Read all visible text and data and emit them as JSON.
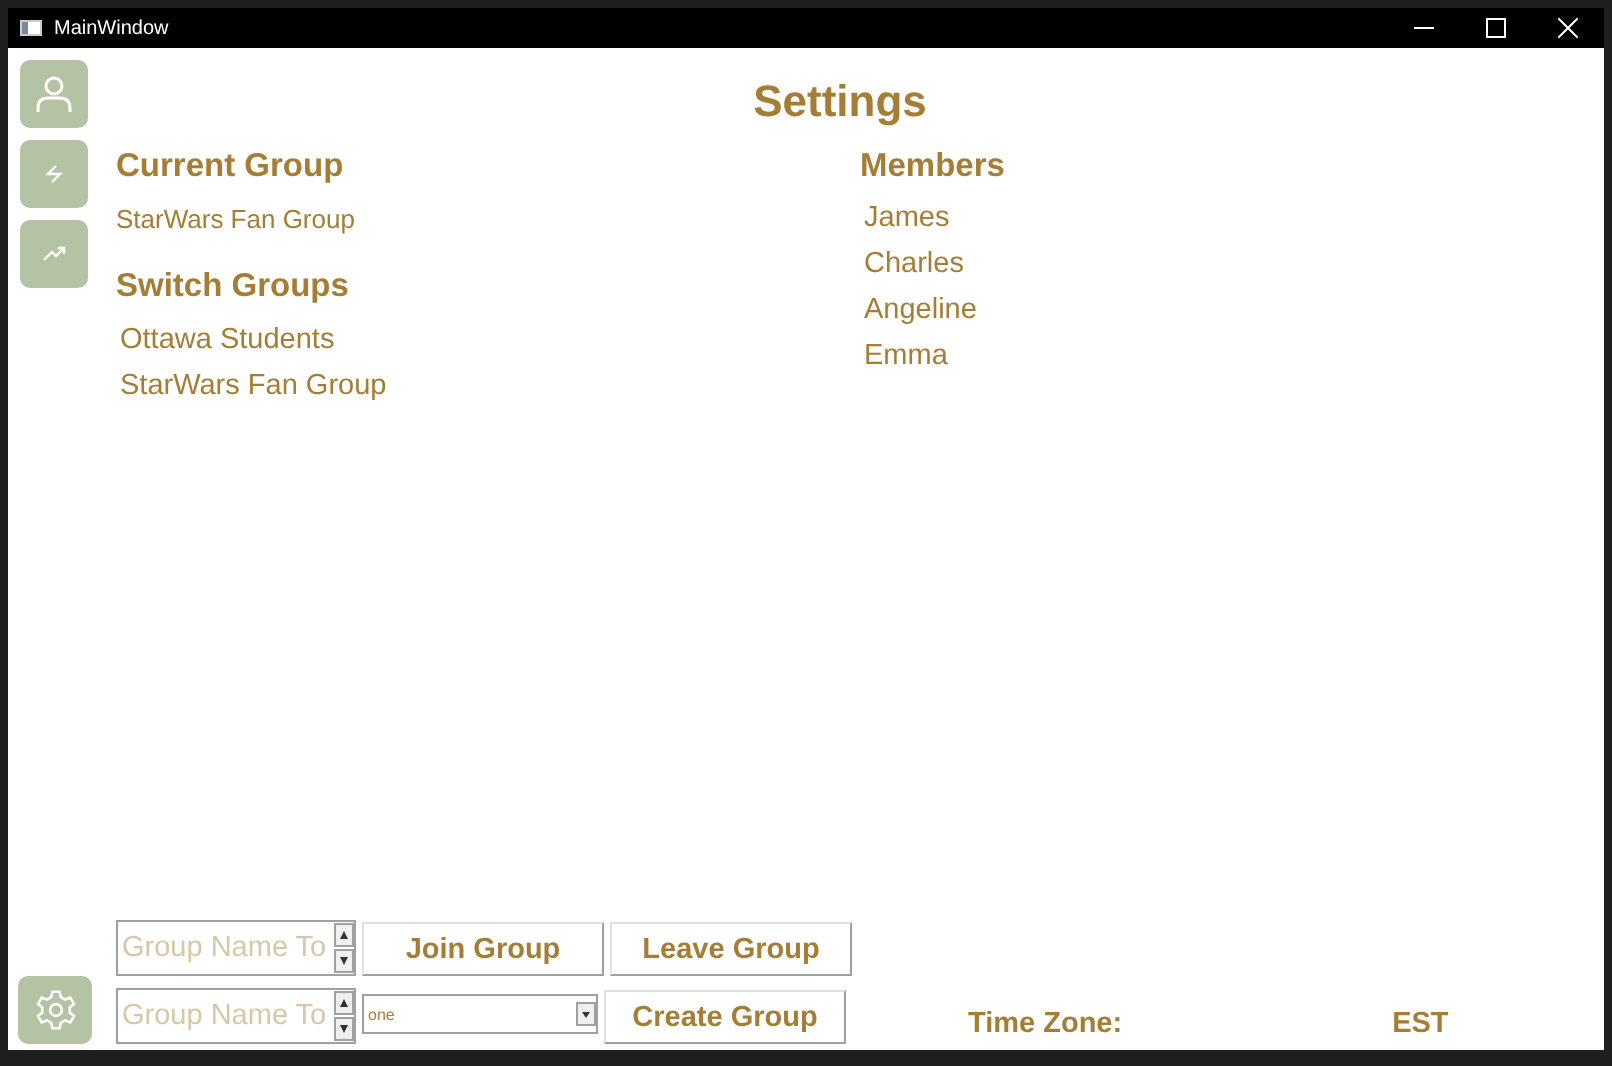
{
  "window": {
    "title": "MainWindow"
  },
  "page_title": "Settings",
  "current_group": {
    "heading": "Current Group",
    "value": "StarWars Fan Group"
  },
  "switch_groups": {
    "heading": "Switch Groups",
    "items": [
      "Ottawa Students",
      "StarWars Fan Group"
    ]
  },
  "members": {
    "heading": "Members",
    "items": [
      "James",
      "Charles",
      "Angeline",
      "Emma"
    ]
  },
  "join_row": {
    "field": {
      "placeholder": "Group Name To"
    },
    "buttons": [
      "Join Group",
      "Leave Group"
    ]
  },
  "create_row": {
    "field": {
      "placeholder": "Group Name To"
    },
    "dropdown": {
      "value": "one"
    },
    "button": "Create Group"
  },
  "time_zone": {
    "label": "Time Zone:",
    "value": "EST"
  }
}
